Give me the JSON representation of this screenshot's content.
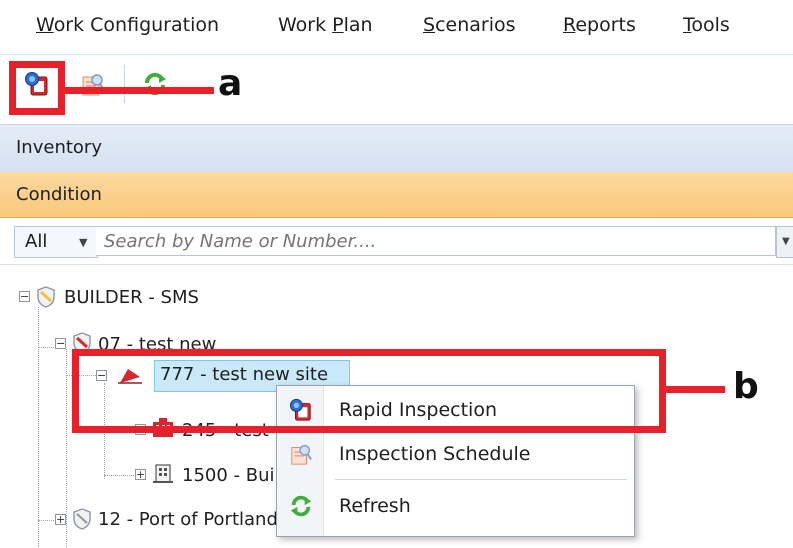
{
  "menu": [
    {
      "pre": "",
      "u": "W",
      "post": "ork Configuration"
    },
    {
      "pre": "Work ",
      "u": "P",
      "post": "lan"
    },
    {
      "pre": "",
      "u": "S",
      "post": "cenarios"
    },
    {
      "pre": "",
      "u": "R",
      "post": "eports"
    },
    {
      "pre": "",
      "u": "T",
      "post": "ools"
    }
  ],
  "toolbar": {
    "icons": [
      "rapid-inspection-icon",
      "inspection-schedule-icon",
      "refresh-icon"
    ]
  },
  "panels": {
    "inventory": "Inventory",
    "condition": "Condition"
  },
  "search": {
    "filter_value": "All",
    "placeholder": "Search by Name or Number...."
  },
  "tree": {
    "root": "BUILDER - SMS",
    "site1": "07 - test new",
    "selected": "777 - test new site",
    "child1": "245 - test",
    "child2": "1500 - Building",
    "site2": "12 - Port of Portland"
  },
  "context_menu": {
    "items": [
      "Rapid Inspection",
      "Inspection Schedule",
      "Refresh"
    ]
  },
  "annotations": {
    "a": "a",
    "b": "b"
  },
  "colors": {
    "accent_red": "#e8202a",
    "condition_bar": "#f9c87b",
    "inventory_bar": "#d5e1f1",
    "selection": "#c9e8f8"
  }
}
